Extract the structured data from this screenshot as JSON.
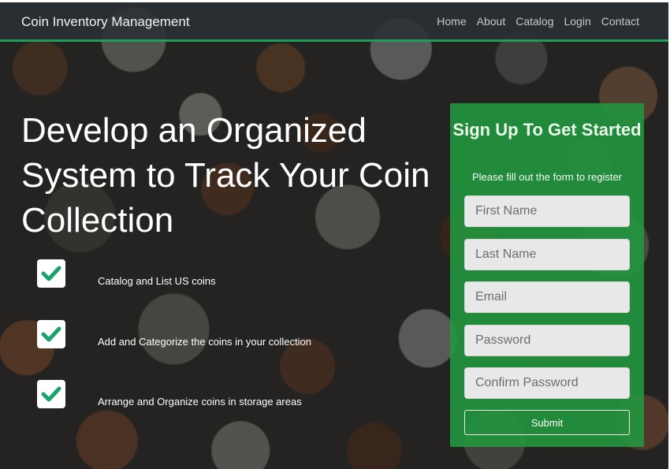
{
  "navbar": {
    "brand": "Coin Inventory Management",
    "links": [
      "Home",
      "About",
      "Catalog",
      "Login",
      "Contact"
    ]
  },
  "hero": {
    "title": "Develop an Organized System to Track Your Coin Collection"
  },
  "features": [
    {
      "icon": "check-icon",
      "text": "Catalog and List US coins"
    },
    {
      "icon": "check-icon",
      "text": "Add and Categorize the coins in your collection"
    },
    {
      "icon": "check-icon",
      "text": "Arrange and Organize coins in storage areas"
    }
  ],
  "signup": {
    "title": "Sign Up To Get Started",
    "subtitle": "Please fill out the form to register",
    "fields": {
      "first_name": {
        "placeholder": "First Name",
        "value": ""
      },
      "last_name": {
        "placeholder": "Last Name",
        "value": ""
      },
      "email": {
        "placeholder": "Email",
        "value": ""
      },
      "password": {
        "placeholder": "Password",
        "value": ""
      },
      "confirm_password": {
        "placeholder": "Confirm Password",
        "value": ""
      }
    },
    "submit_label": "Submit"
  },
  "colors": {
    "accent": "#1e9e5a",
    "panel": "#22963e",
    "check": "#1aa36a",
    "navbar": "#2a3036"
  }
}
